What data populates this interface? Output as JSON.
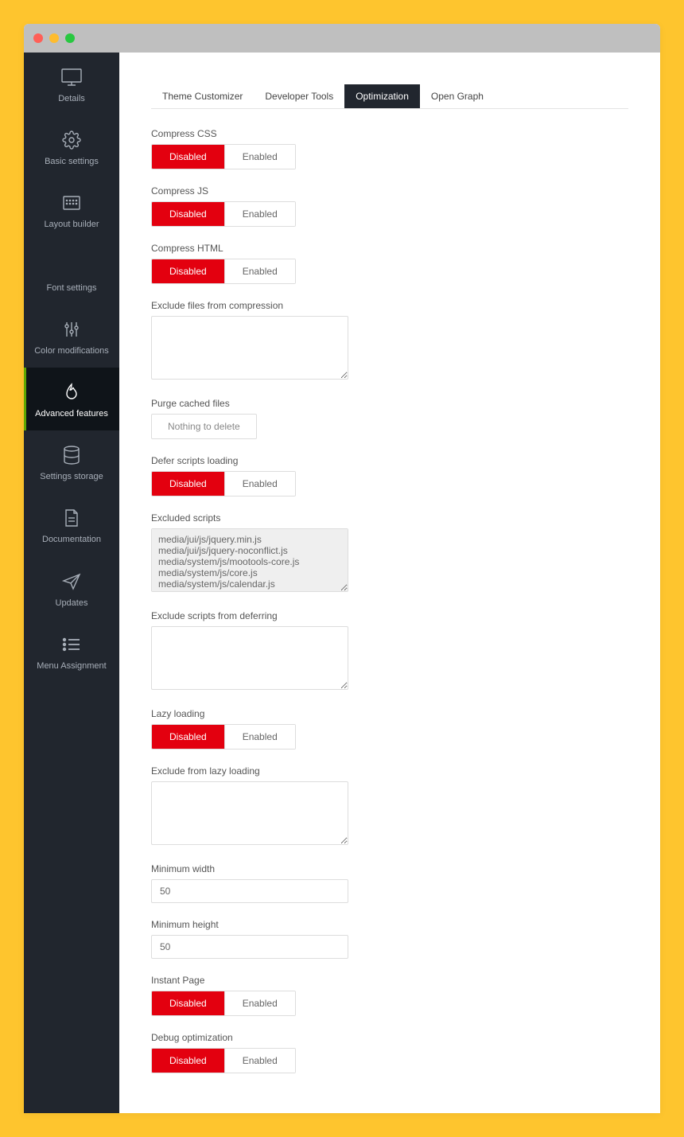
{
  "sidebar": {
    "items": [
      {
        "label": "Details",
        "icon": "monitor"
      },
      {
        "label": "Basic settings",
        "icon": "gear"
      },
      {
        "label": "Layout builder",
        "icon": "grid"
      },
      {
        "label": "Font settings",
        "icon": "font"
      },
      {
        "label": "Color modifications",
        "icon": "sliders"
      },
      {
        "label": "Advanced features",
        "icon": "flame",
        "active": true
      },
      {
        "label": "Settings storage",
        "icon": "database"
      },
      {
        "label": "Documentation",
        "icon": "document"
      },
      {
        "label": "Updates",
        "icon": "plane"
      },
      {
        "label": "Menu Assignment",
        "icon": "list"
      }
    ]
  },
  "tabs": [
    {
      "label": "Theme Customizer"
    },
    {
      "label": "Developer Tools"
    },
    {
      "label": "Optimization",
      "active": true
    },
    {
      "label": "Open Graph"
    }
  ],
  "toggle": {
    "disabled": "Disabled",
    "enabled": "Enabled"
  },
  "fields": {
    "compress_css": {
      "label": "Compress CSS",
      "value": "Disabled"
    },
    "compress_js": {
      "label": "Compress JS",
      "value": "Disabled"
    },
    "compress_html": {
      "label": "Compress HTML",
      "value": "Disabled"
    },
    "exclude_compression": {
      "label": "Exclude files from compression",
      "value": ""
    },
    "purge_cache": {
      "label": "Purge cached files",
      "button": "Nothing to delete"
    },
    "defer_scripts": {
      "label": "Defer scripts loading",
      "value": "Disabled"
    },
    "excluded_scripts": {
      "label": "Excluded scripts",
      "value": "media/jui/js/jquery.min.js\nmedia/jui/js/jquery-noconflict.js\nmedia/system/js/mootools-core.js\nmedia/system/js/core.js\nmedia/system/js/calendar.js\nmedia/system/js/calendar-setup.js"
    },
    "exclude_deferring": {
      "label": "Exclude scripts from deferring",
      "value": ""
    },
    "lazy_loading": {
      "label": "Lazy loading",
      "value": "Disabled"
    },
    "exclude_lazy": {
      "label": "Exclude from lazy loading",
      "value": ""
    },
    "min_width": {
      "label": "Minimum width",
      "value": "50"
    },
    "min_height": {
      "label": "Minimum height",
      "value": "50"
    },
    "instant_page": {
      "label": "Instant Page",
      "value": "Disabled"
    },
    "debug_optimization": {
      "label": "Debug optimization",
      "value": "Disabled"
    }
  }
}
